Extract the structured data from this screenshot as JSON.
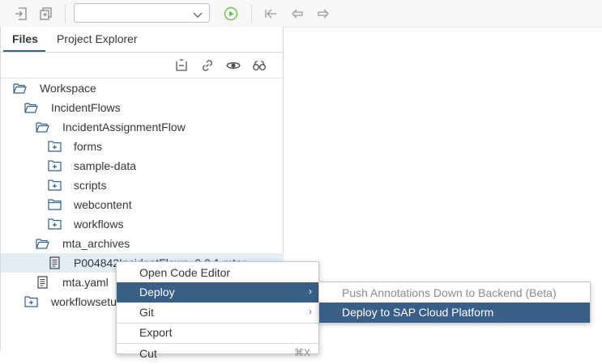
{
  "toolbar": {
    "run_config_value": "",
    "icons": [
      "import-icon",
      "export-icon",
      "chevron-down-icon",
      "run-icon",
      "step-back-icon",
      "back-icon",
      "forward-icon"
    ]
  },
  "tabs": {
    "files": "Files",
    "project_explorer": "Project Explorer"
  },
  "tree_toolbar": {
    "icons": [
      "collapse-icon",
      "link-icon",
      "eye-icon",
      "search-glasses-icon"
    ]
  },
  "tree": [
    {
      "label": "Workspace",
      "icon": "folder-open-icon"
    },
    {
      "label": "IncidentFlows",
      "icon": "folder-open-icon"
    },
    {
      "label": "IncidentAssignmentFlow",
      "icon": "folder-open-icon"
    },
    {
      "label": "forms",
      "icon": "folder-plus-icon"
    },
    {
      "label": "sample-data",
      "icon": "folder-plus-icon"
    },
    {
      "label": "scripts",
      "icon": "folder-plus-icon"
    },
    {
      "label": "webcontent",
      "icon": "folder-icon"
    },
    {
      "label": "workflows",
      "icon": "folder-plus-icon"
    },
    {
      "label": "mta_archives",
      "icon": "folder-open-icon"
    },
    {
      "label": "P004842IncidentFlows_0.0.1.mtar",
      "icon": "file-icon"
    },
    {
      "label": "mta.yaml",
      "icon": "file-icon"
    },
    {
      "label": "workflowsetup",
      "icon": "folder-plus-icon"
    }
  ],
  "context_menu": {
    "items": [
      "Open Code Editor",
      "Deploy",
      "Git",
      "Export",
      "Cut"
    ],
    "cut_shortcut": "⌘X"
  },
  "submenu": {
    "items": [
      "Push Annotations Down to Backend (Beta)",
      "Deploy to SAP Cloud Platform"
    ]
  },
  "colors": {
    "accent": "#346187",
    "menu_active": "#3a5f86",
    "selection": "#e4edf5",
    "run_green": "#6cc04a"
  }
}
